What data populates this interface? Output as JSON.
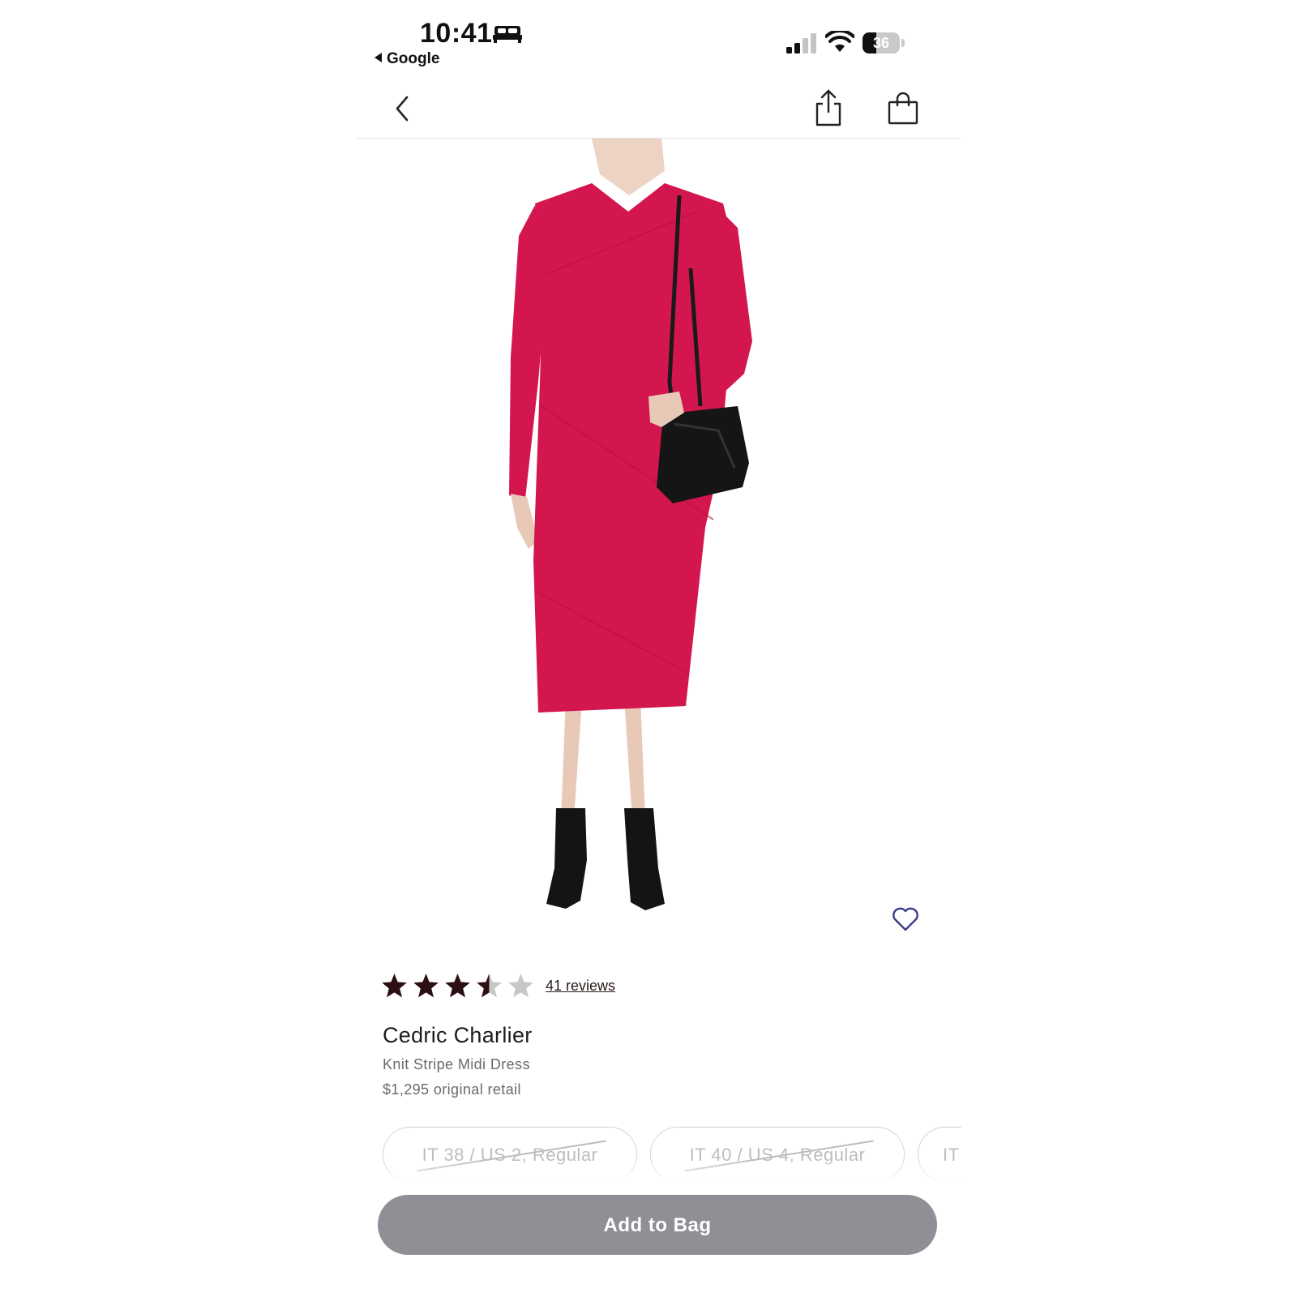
{
  "status_bar": {
    "time": "10:41",
    "back_app_label": "Google",
    "battery_level": 36,
    "battery_text": "36"
  },
  "nav": {
    "back_icon": "chevron-left-icon",
    "share_icon": "share-icon",
    "bag_icon": "shopping-bag-icon"
  },
  "product": {
    "image_alt": "",
    "rating": 3.5,
    "rating_max": 5,
    "reviews_label": "41 reviews",
    "designer": "Cedric Charlier",
    "name": "Knit Stripe Midi Dress",
    "price": "$1,295 original retail",
    "favorite_icon": "heart-outline-icon",
    "dress_color": "#d4164f"
  },
  "sizes": [
    {
      "label": "IT 38 / US 2, Regular",
      "available": false
    },
    {
      "label": "IT 40 / US 4, Regular",
      "available": false
    },
    {
      "label": "IT",
      "available": false
    }
  ],
  "actions": {
    "add_to_bag_label": "Add to Bag",
    "add_to_bag_color": "#8f9096"
  },
  "colors": {
    "star_filled": "#2b0f12",
    "star_empty": "#c7c7c7",
    "heart": "#3b3c8a"
  }
}
